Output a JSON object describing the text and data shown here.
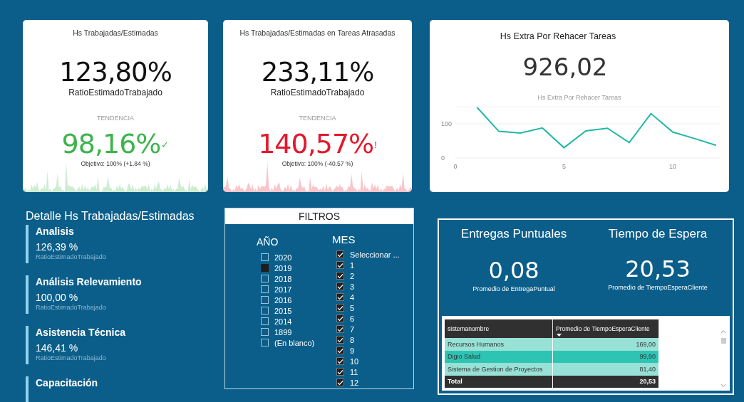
{
  "kpi_cards": [
    {
      "title": "Hs Trabajadas/Estimadas",
      "value": "123,80%",
      "label": "RatioEstimadoTrabajado",
      "trend_label": "TENDENCIA",
      "trend_value": "98,16%",
      "color": "#3cb44b",
      "indicator": "✓",
      "goal": "Objetivo: 100% (+1.84 %)"
    },
    {
      "title": "Hs Trabajadas/Estimadas en Tareas Atrasadas",
      "value": "233,11%",
      "label": "RatioEstimadoTrabajado",
      "trend_label": "TENDENCIA",
      "trend_value": "140,57%",
      "color": "#e3182d",
      "indicator": "!",
      "goal": "Objetivo: 100% (-40.57 %)"
    }
  ],
  "extra_card": {
    "title": "Hs Extra Por Rehacer Tareas",
    "value": "926,02",
    "chart_data": {
      "type": "line",
      "title": "Hs Extra Por Rehacer Tareas",
      "x": [
        1,
        2,
        3,
        4,
        5,
        6,
        7,
        8,
        9,
        10,
        11,
        12
      ],
      "series": [
        {
          "color": "#1fb8a6",
          "values": [
            148,
            78,
            73,
            88,
            30,
            79,
            87,
            45,
            130,
            76,
            57,
            37
          ]
        }
      ],
      "xlim": [
        0,
        12.2
      ],
      "ylim": [
        0,
        150
      ],
      "xticks": [
        0,
        5,
        10
      ],
      "yticks": [
        0,
        100
      ]
    }
  },
  "detail": {
    "title": "Detalle Hs Trabajadas/Estimadas",
    "items": [
      {
        "name": "Analisis",
        "value": "126,39 %",
        "label": "RatioEstimadoTrabajado"
      },
      {
        "name": "Análisis Relevamiento",
        "value": "100,00 %",
        "label": "RatioEstimadoTrabajado"
      },
      {
        "name": "Asistencia Técnica",
        "value": "146,41 %",
        "label": "RatioEstimadoTrabajado"
      },
      {
        "name": "Capacitación"
      }
    ]
  },
  "filters": {
    "title": "FILTROS",
    "year": {
      "title": "AÑO",
      "options": [
        {
          "label": "2020",
          "checked": false
        },
        {
          "label": "2019",
          "checked": true
        },
        {
          "label": "2018",
          "checked": false
        },
        {
          "label": "2017",
          "checked": false
        },
        {
          "label": "2016",
          "checked": false
        },
        {
          "label": "2015",
          "checked": false
        },
        {
          "label": "2014",
          "checked": false
        },
        {
          "label": "1899",
          "checked": false
        },
        {
          "label": "(En blanco)",
          "checked": false
        }
      ]
    },
    "month": {
      "title": "MES",
      "options": [
        {
          "label": "Seleccionar ...",
          "checked": true
        },
        {
          "label": "1",
          "checked": true
        },
        {
          "label": "2",
          "checked": true
        },
        {
          "label": "3",
          "checked": true
        },
        {
          "label": "4",
          "checked": true
        },
        {
          "label": "5",
          "checked": true
        },
        {
          "label": "6",
          "checked": true
        },
        {
          "label": "7",
          "checked": true
        },
        {
          "label": "8",
          "checked": true
        },
        {
          "label": "9",
          "checked": true
        },
        {
          "label": "10",
          "checked": true
        },
        {
          "label": "11",
          "checked": true
        },
        {
          "label": "12",
          "checked": true
        }
      ]
    }
  },
  "summary": {
    "metrics": [
      {
        "title": "Entregas Puntuales",
        "value": "0,08",
        "label": "Promedio de EntregaPuntual"
      },
      {
        "title": "Tiempo de Espera",
        "value": "20,53",
        "label": "Promedio de TiempoEsperaCliente"
      }
    ],
    "table": {
      "columns": [
        "sistemanombre",
        "Promedio de TiempoEsperaCliente"
      ],
      "rows": [
        [
          "Recursos Humanos",
          "169,00"
        ],
        [
          "Digio Salud",
          "99,90"
        ],
        [
          "Sistema de Gestion de Proyectos",
          "81,40"
        ]
      ],
      "total": [
        "Total",
        "20,53"
      ]
    }
  }
}
